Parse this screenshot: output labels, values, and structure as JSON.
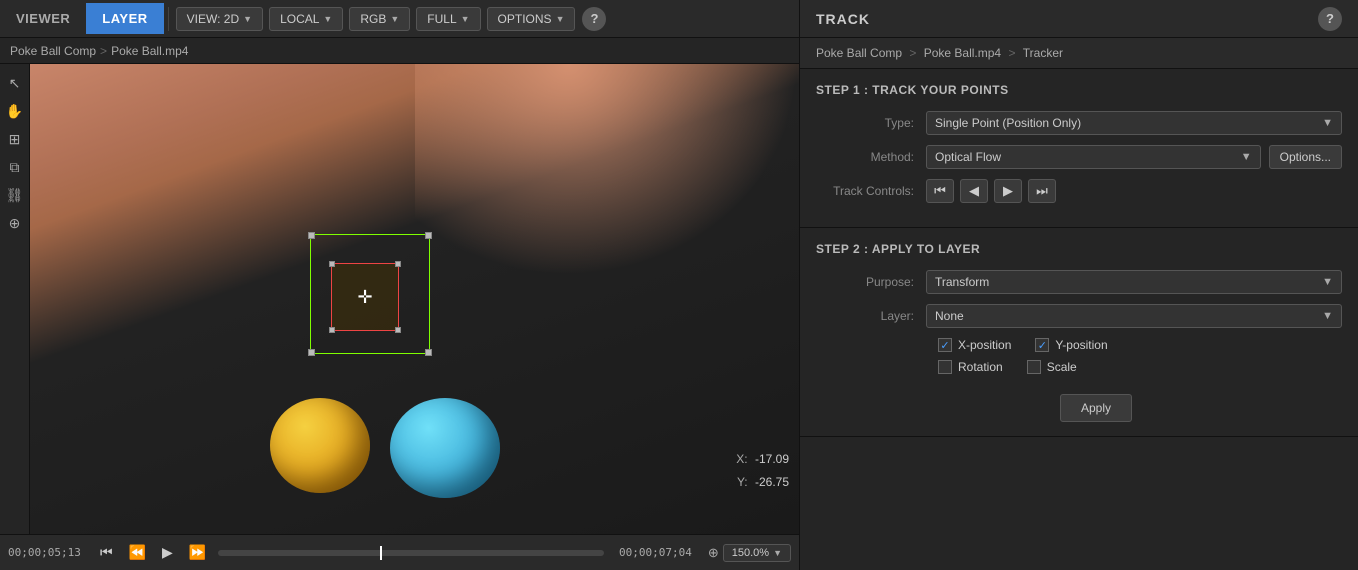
{
  "topBar": {
    "tabs": [
      {
        "id": "viewer",
        "label": "VIEWER",
        "active": false
      },
      {
        "id": "layer",
        "label": "LAYER",
        "active": true
      }
    ],
    "dropdowns": [
      {
        "id": "view",
        "label": "VIEW: 2D"
      },
      {
        "id": "local",
        "label": "LOCAL"
      },
      {
        "id": "rgb",
        "label": "RGB"
      },
      {
        "id": "full",
        "label": "FULL"
      },
      {
        "id": "options",
        "label": "OPTIONS"
      }
    ],
    "helpLabel": "?"
  },
  "rightTopBar": {
    "title": "TRACK",
    "helpLabel": "?"
  },
  "breadcrumb": {
    "left": {
      "parts": [
        "Poke Ball Comp",
        "Poke Ball.mp4"
      ],
      "separator": ">"
    },
    "right": {
      "parts": [
        "Poke Ball Comp",
        "Poke Ball.mp4",
        "Tracker"
      ],
      "separator": ">"
    }
  },
  "step1": {
    "title": "STEP 1 : TRACK YOUR POINTS",
    "typeLabel": "Type:",
    "typeValue": "Single Point (Position Only)",
    "methodLabel": "Method:",
    "methodValue": "Optical Flow",
    "optionsLabel": "Options...",
    "trackControlsLabel": "Track Controls:"
  },
  "step2": {
    "title": "STEP 2 : APPLY TO LAYER",
    "purposeLabel": "Purpose:",
    "purposeValue": "Transform",
    "layerLabel": "Layer:",
    "layerValue": "None",
    "checkboxes": [
      {
        "id": "xpos",
        "label": "X-position",
        "checked": true
      },
      {
        "id": "ypos",
        "label": "Y-position",
        "checked": true
      },
      {
        "id": "rotation",
        "label": "Rotation",
        "checked": false
      },
      {
        "id": "scale",
        "label": "Scale",
        "checked": false
      }
    ],
    "applyLabel": "Apply"
  },
  "viewer": {
    "coords": {
      "xLabel": "X:",
      "xValue": "-17.09",
      "yLabel": "Y:",
      "yValue": "-26.75"
    },
    "zoom": {
      "value": "150.0%"
    },
    "timeline": {
      "startTime": "00;00;05;13",
      "endTime": "00;00;07;04"
    }
  },
  "icons": {
    "select": "↖",
    "hand": "✋",
    "grid": "⊞",
    "layers": "⧉",
    "link": "⛓",
    "magnify": "⊕"
  }
}
